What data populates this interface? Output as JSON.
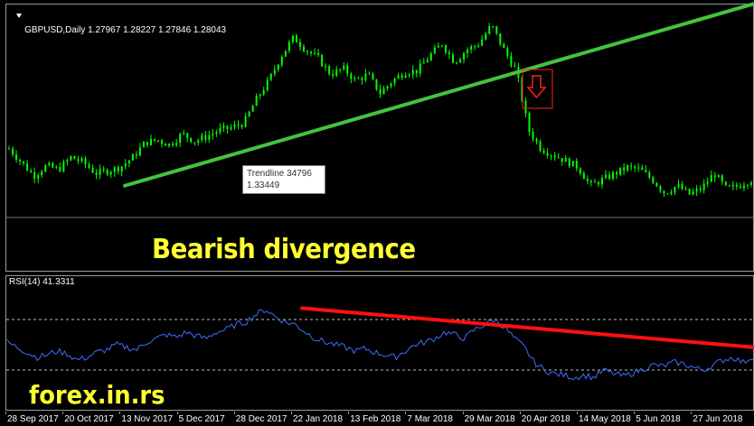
{
  "price_header": {
    "symbol": "GBPUSD,Daily",
    "ohlc": "1.27967 1.28227 1.27846 1.28043"
  },
  "rsi_header": {
    "label": "RSI(14) 41.3311"
  },
  "tooltip": {
    "line1": "Trendline 34796",
    "line2": "1.33449"
  },
  "annotation": {
    "title": "Bearish divergence"
  },
  "watermark": "forex.in.rs",
  "colors": {
    "candle": "#00ff00",
    "price_trendline": "#43c43b",
    "rsi_line": "#3b6fff",
    "rsi_trendline": "#ff1010",
    "signal_box": "#ff2020",
    "label_yellow": "#ffff33"
  },
  "icons": {
    "signal": "down-arrow-icon",
    "collapse": "triangle-down-icon"
  },
  "chart_data": [
    {
      "type": "candlestick",
      "name": "price",
      "x_axis_labels": [
        "28 Sep 2017",
        "20 Oct 2017",
        "13 Nov 2017",
        "5 Dec 2017",
        "28 Dec 2017",
        "22 Jan 2018",
        "13 Feb 2018",
        "7 Mar 2018",
        "29 Mar 2018",
        "20 Apr 2018",
        "14 May 2018",
        "5 Jun 2018",
        "27 Jun 2018"
      ],
      "close_path": [
        1.335,
        1.324,
        1.313,
        1.321,
        1.318,
        1.328,
        1.324,
        1.315,
        1.317,
        1.32,
        1.328,
        1.34,
        1.342,
        1.338,
        1.347,
        1.341,
        1.345,
        1.35,
        1.352,
        1.356,
        1.375,
        1.39,
        1.41,
        1.425,
        1.415,
        1.408,
        1.395,
        1.4,
        1.39,
        1.395,
        1.38,
        1.39,
        1.397,
        1.398,
        1.41,
        1.42,
        1.405,
        1.415,
        1.42,
        1.435,
        1.415,
        1.398,
        1.35,
        1.335,
        1.33,
        1.325,
        1.32,
        1.305,
        1.31,
        1.315,
        1.32,
        1.318,
        1.31,
        1.299,
        1.305,
        1.298,
        1.303,
        1.315,
        1.302,
        1.305,
        1.31
      ],
      "trendline": {
        "start_price": 1.305,
        "end_price": 1.452,
        "tooltip_value": 1.33449
      },
      "y_range": [
        1.28,
        1.445
      ]
    },
    {
      "type": "line",
      "name": "RSI(14)",
      "current": 41.3311,
      "levels": [
        70,
        30
      ],
      "values": [
        52,
        48,
        44,
        40,
        42,
        45,
        43,
        38,
        40,
        44,
        46,
        50,
        48,
        46,
        52,
        55,
        58,
        56,
        60,
        57,
        55,
        60,
        62,
        66,
        68,
        74,
        78,
        72,
        68,
        66,
        60,
        55,
        52,
        50,
        48,
        45,
        47,
        44,
        42,
        40,
        45,
        50,
        52,
        55,
        60,
        58,
        55,
        62,
        66,
        70,
        64,
        55,
        48,
        36,
        30,
        27,
        26,
        24,
        26,
        24,
        30,
        27,
        25,
        28,
        31,
        34,
        33,
        36,
        35,
        32,
        30,
        34,
        38,
        40,
        36,
        41
      ],
      "trendline": {
        "start": 79,
        "end": 48
      },
      "y_range": [
        0,
        100
      ]
    }
  ]
}
